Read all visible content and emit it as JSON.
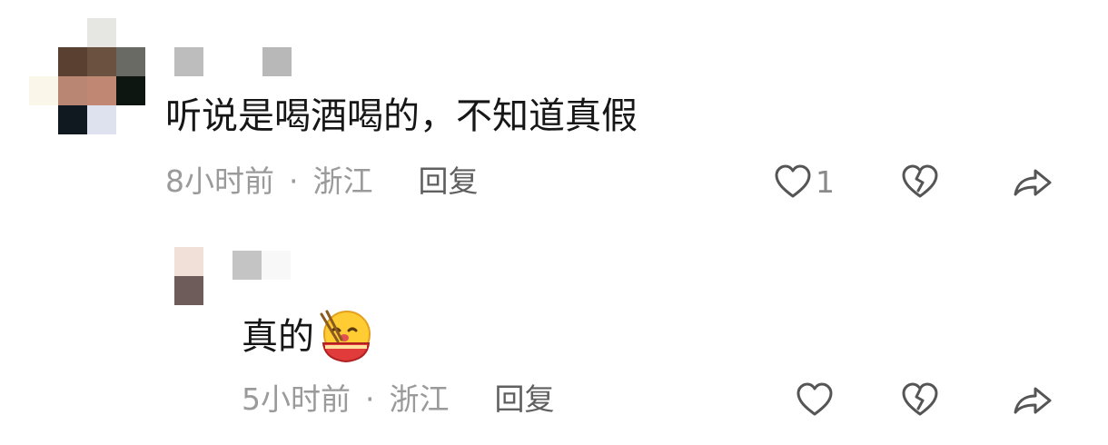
{
  "comments": [
    {
      "text": "听说是喝酒喝的，不知道真假",
      "time": "8小时前",
      "location": "浙江",
      "reply_label": "回复",
      "like_count": "1",
      "icons": [
        "heart-outline-icon",
        "broken-heart-icon",
        "share-arrow-icon"
      ]
    },
    {
      "text": "真的",
      "emoji": "eating-noodles-emoji",
      "time": "5小时前",
      "location": "浙江",
      "reply_label": "回复",
      "icons": [
        "heart-outline-icon",
        "broken-heart-icon",
        "share-arrow-icon"
      ]
    }
  ],
  "separator": "·",
  "colors": {
    "text": "#161616",
    "meta": "#9a9a9a",
    "reply": "#5f5f5f",
    "icon": "#555555",
    "emoji_face": "#ffcc33",
    "emoji_bowl": "#e23b3b"
  }
}
